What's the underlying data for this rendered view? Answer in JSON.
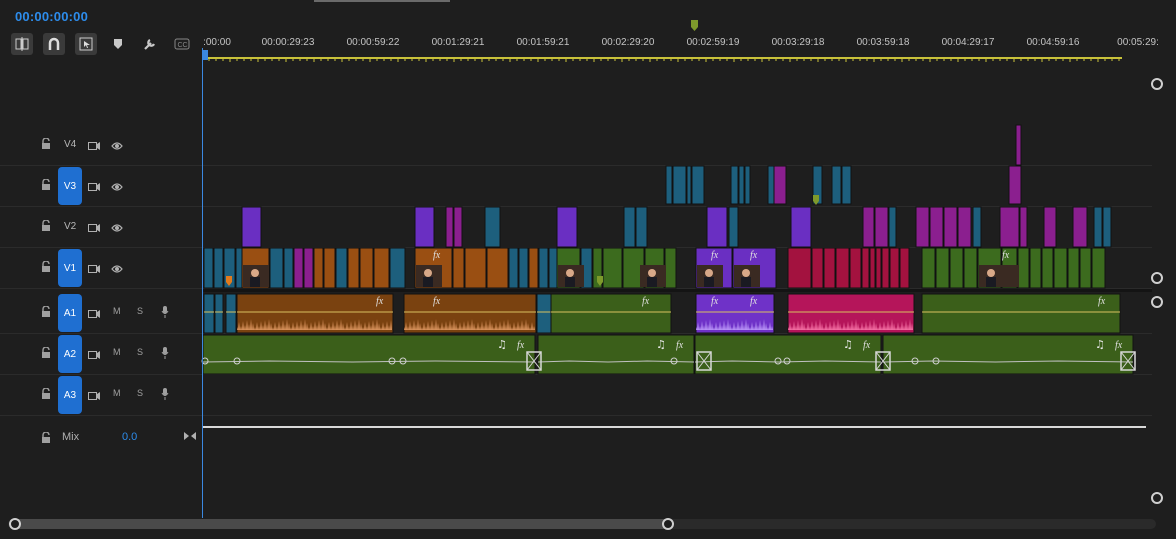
{
  "timecode": "00:00:00:00",
  "toolbar": {
    "icons": [
      "insert-sequence-icon",
      "snap-magnet-icon",
      "linked-selection-icon",
      "add-marker-icon",
      "wrench-settings-icon",
      "captions-icon"
    ]
  },
  "ruler": {
    "labels": [
      ":00:00",
      "00:00:29:23",
      "00:00:59:22",
      "00:01:29:21",
      "00:01:59:21",
      "00:02:29:20",
      "00:02:59:19",
      "00:03:29:18",
      "00:03:59:18",
      "00:04:29:17",
      "00:04:59:16",
      "00:05:29:"
    ]
  },
  "tracks": {
    "video": [
      {
        "label": "V4",
        "targeted": false
      },
      {
        "label": "V3",
        "targeted": true
      },
      {
        "label": "V2",
        "targeted": false
      },
      {
        "label": "V1",
        "targeted": true
      }
    ],
    "audio": [
      {
        "label": "A1",
        "m": "M",
        "s": "S"
      },
      {
        "label": "A2",
        "m": "M",
        "s": "S"
      },
      {
        "label": "A3",
        "m": "M",
        "s": "S"
      }
    ],
    "mix": {
      "label": "Mix",
      "value": "0.0"
    }
  },
  "clip_labels": {
    "fx": "fx",
    "music": "♫"
  },
  "colors": {
    "accent": "#2d8ceb",
    "teal": "#1d5f7d",
    "purple": "#6a2fc2",
    "magenta": "#8b1f8f",
    "orange": "#9a4f12",
    "green": "#3c6b1e",
    "crimson": "#a3123f",
    "audio_orange": "#7a4210",
    "audio_green": "#3b5f1a",
    "audio_purple": "#6f32c8",
    "audio_pink": "#b5155a"
  }
}
